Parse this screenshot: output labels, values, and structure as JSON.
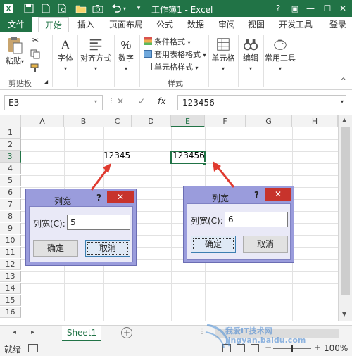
{
  "title_bar": {
    "title": "工作簿1 - Excel",
    "app_icon": "excel-logo",
    "window_controls": [
      "?",
      "▣",
      "—",
      "☐",
      "✕"
    ]
  },
  "ribbon_tabs": [
    "文件",
    "开始",
    "插入",
    "页面布局",
    "公式",
    "数据",
    "审阅",
    "视图",
    "开发工具"
  ],
  "active_tab": "开始",
  "login_label": "登录",
  "ribbon": {
    "clipboard": {
      "paste": "粘贴",
      "group": "剪贴板"
    },
    "font": "字体",
    "alignment": "对齐方式",
    "number": "数字",
    "styles": {
      "conditional": "条件格式",
      "table": "套用表格格式",
      "cell_style": "单元格样式",
      "group": "样式"
    },
    "cells": "单元格",
    "editing": "编辑",
    "tools": "常用工具"
  },
  "formula_bar": {
    "name_box": "E3",
    "cancel_icon": "✕",
    "enter_icon": "✓",
    "fx_label": "fx",
    "value": "123456"
  },
  "columns": [
    "A",
    "B",
    "C",
    "D",
    "E",
    "F",
    "G",
    "H"
  ],
  "selected_column": "E",
  "rows": [
    "1",
    "2",
    "3",
    "4",
    "5",
    "6",
    "7",
    "8",
    "9",
    "10",
    "11",
    "12",
    "13",
    "14",
    "15",
    "16"
  ],
  "selected_row": "3",
  "cells": {
    "c3": "12345",
    "e3": "123456"
  },
  "sheet_tab": "Sheet1",
  "status": {
    "ready": "就绪",
    "zoom": "100%"
  },
  "dialog_left": {
    "title": "列宽",
    "help": "?",
    "close": "✕",
    "label": "列宽(C):",
    "value": "5",
    "ok": "确定",
    "cancel": "取消"
  },
  "dialog_right": {
    "title": "列宽",
    "help": "?",
    "close": "✕",
    "label": "列宽(C):",
    "value": "6",
    "ok": "确定",
    "cancel": "取消"
  },
  "watermark": "我爱IT技术网 jingyan.baidu.com",
  "colors": {
    "excel_green": "#217346",
    "dialog_frame": "#9a9cdc",
    "close_red": "#c7332c",
    "arrow_red": "#e03a2f"
  }
}
